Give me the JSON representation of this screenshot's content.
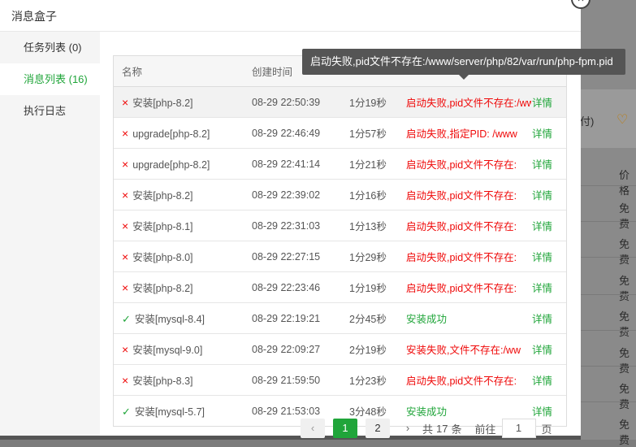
{
  "modal": {
    "title": "消息盒子",
    "close_symbol": "×"
  },
  "sidebar": {
    "items": [
      {
        "label": "任务列表 (0)",
        "active": false
      },
      {
        "label": "消息列表 (16)",
        "active": true
      },
      {
        "label": "执行日志",
        "active": false
      }
    ]
  },
  "table": {
    "headers": [
      "名称",
      "创建时间",
      "",
      "",
      ""
    ],
    "rows": [
      {
        "status": "fail",
        "name": "安装[php-8.2]",
        "time": "08-29 22:50:39",
        "duration": "1分19秒",
        "result": "启动失败,pid文件不存在:/www/server/php/82/var/run/php-fpm.pid",
        "action": "详情"
      },
      {
        "status": "fail",
        "name": "upgrade[php-8.2]",
        "time": "08-29 22:46:49",
        "duration": "1分57秒",
        "result": "启动失败,指定PID: /www",
        "action": "详情"
      },
      {
        "status": "fail",
        "name": "upgrade[php-8.2]",
        "time": "08-29 22:41:14",
        "duration": "1分21秒",
        "result": "启动失败,pid文件不存在:",
        "action": "详情"
      },
      {
        "status": "fail",
        "name": "安装[php-8.2]",
        "time": "08-29 22:39:02",
        "duration": "1分16秒",
        "result": "启动失败,pid文件不存在:",
        "action": "详情"
      },
      {
        "status": "fail",
        "name": "安装[php-8.1]",
        "time": "08-29 22:31:03",
        "duration": "1分13秒",
        "result": "启动失败,pid文件不存在:",
        "action": "详情"
      },
      {
        "status": "fail",
        "name": "安装[php-8.0]",
        "time": "08-29 22:27:15",
        "duration": "1分29秒",
        "result": "启动失败,pid文件不存在:",
        "action": "详情"
      },
      {
        "status": "fail",
        "name": "安装[php-8.2]",
        "time": "08-29 22:23:46",
        "duration": "1分19秒",
        "result": "启动失败,pid文件不存在:",
        "action": "详情"
      },
      {
        "status": "success",
        "name": "安装[mysql-8.4]",
        "time": "08-29 22:19:21",
        "duration": "2分45秒",
        "result": "安装成功",
        "action": "详情"
      },
      {
        "status": "fail",
        "name": "安装[mysql-9.0]",
        "time": "08-29 22:09:27",
        "duration": "2分19秒",
        "result": "安装失败,文件不存在:/ww",
        "action": "详情"
      },
      {
        "status": "fail",
        "name": "安装[php-8.3]",
        "time": "08-29 21:59:50",
        "duration": "1分23秒",
        "result": "启动失败,pid文件不存在:",
        "action": "详情"
      },
      {
        "status": "success",
        "name": "安装[mysql-5.7]",
        "time": "08-29 21:53:03",
        "duration": "3分48秒",
        "result": "安装成功",
        "action": "详情"
      }
    ]
  },
  "pagination": {
    "prev": "‹",
    "next": "›",
    "pages": [
      "1",
      "2"
    ],
    "current": "1",
    "total_prefix": "共",
    "total": "17",
    "total_suffix": "条",
    "goto_prefix": "前往",
    "goto_value": "1",
    "goto_suffix": "页"
  },
  "tooltip": {
    "text": "启动失败,pid文件不存在:/www/server/php/82/var/run/php-fpm.pid"
  },
  "background": {
    "texts": [
      "付)",
      "价格",
      "免费",
      "免费",
      "免费",
      "免费",
      "免费",
      "免费",
      "免费"
    ]
  },
  "colors": {
    "accent": "#20a53a",
    "error": "#ef0808",
    "tooltip_bg": "#555555"
  },
  "icons": {
    "fail": "×",
    "success": "✓",
    "heart": "♡"
  }
}
